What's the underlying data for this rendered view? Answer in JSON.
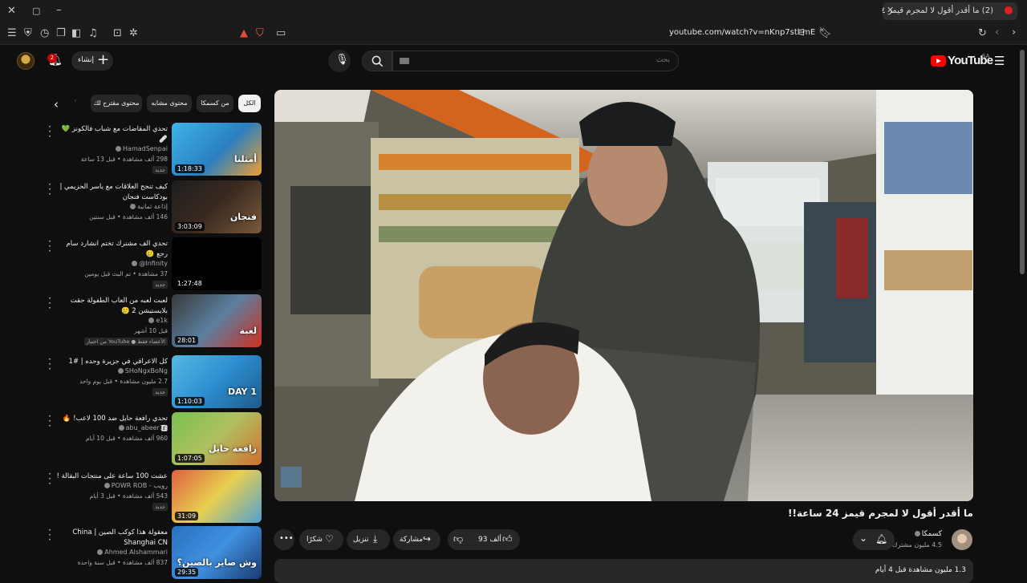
{
  "browser": {
    "tab_title": "(2) ما أقدر أقول لا لمجرم قيمز ٢٤",
    "url": "youtube.com/watch?v=nKnp7stl-mE"
  },
  "header": {
    "brand": "YouTube",
    "region": "SA",
    "search_placeholder": "بحث",
    "create_label": "إنشاء",
    "notification_count": "2"
  },
  "chips": [
    "الكل",
    "من كسمكا",
    "محتوى مشابه",
    "محتوى مقترح لك"
  ],
  "video": {
    "title": "ما أقدر أقول لا لمجرم قيمز 24 ساعة!!",
    "channel": "كسمكا",
    "subscribers": "4.5 مليون مشترك",
    "likes": "93 ألف",
    "share_label": "مشاركة",
    "download_label": "تنزيل",
    "thanks_label": "شكرًا",
    "description": "1.3 مليون مشاهدة قبل 4 أيام"
  },
  "recommendations": [
    {
      "title": "تحدي المقاضات مع شباب فالكونز 💚 🩹",
      "channel": "HamadSenpai",
      "meta": "298 ألف مشاهدة • قبل 13 ساعة",
      "badge": "جديد",
      "duration": "1:18:33"
    },
    {
      "title": "كيف تنجح العلاقات مع ياسر الحزيمي | بودكاست فنجان",
      "channel": "إذاعة ثمانية",
      "meta": "146 ألف مشاهدة • قبل سنتين",
      "badge": "",
      "duration": "3:03:09"
    },
    {
      "title": "تحدي الف مشترك تختم انشارد سام رجع 🥲",
      "channel": "Infinity@",
      "meta": "37 مشاهدة • تم البث قبل يومين",
      "badge": "جديد",
      "duration": "1:27:48"
    },
    {
      "title": "لعبت لعبه من العاب الطفولة حقت بلايستيشن 2 🥲",
      "channel": "e1k",
      "meta": "قبل 10 أشهر",
      "badge": "من اختيار YouTube ● الأعضاء فقط",
      "duration": "28:01"
    },
    {
      "title": "كل الاعراقي في جزيرة وحده | #1",
      "channel": "SHoNgxBoNg",
      "meta": "2.7 مليون مشاهدة • قبل يوم واحد",
      "badge": "جديد",
      "duration": "1:10:03"
    },
    {
      "title": "تحدي رافعة حايل ضد 100 لاعب! 🔥 🅴",
      "channel": "abu_abeer16",
      "meta": "960 ألف مشاهدة • قبل 10 أيام",
      "badge": "",
      "duration": "1:07:05"
    },
    {
      "title": "عشت 100 ساعة على منتجات البقالة !",
      "channel": "رويب - POWR ROB",
      "meta": "543 ألف مشاهدة • قبل 3 أيام",
      "badge": "جديد",
      "duration": "31:09"
    },
    {
      "title": "معقولة هذا كوكب الصين China | Shanghai CN",
      "channel": "Ahmed Alshammari",
      "meta": "837 ألف مشاهدة • قبل سنة واحدة",
      "badge": "",
      "duration": "29:35"
    }
  ],
  "thumb_texts": [
    "أمثلنا",
    "فنجان",
    "",
    "لعبة",
    "DAY 1",
    "رافعة حايل",
    "",
    "وش صاير بالصين؟"
  ],
  "colors": {
    "accent": "#ff0000",
    "background": "#0f0f0f",
    "surface": "#272727"
  }
}
